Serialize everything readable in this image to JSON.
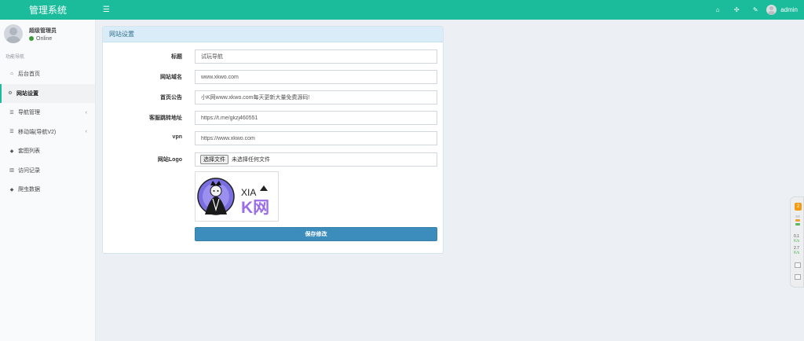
{
  "header": {
    "app_title": "管理系统",
    "menu_icon": "hamburger-icon",
    "right_icons": [
      "home-icon",
      "expand-icon",
      "wrench-icon"
    ],
    "user": "admin"
  },
  "sidebar": {
    "user_name": "超级管理员",
    "status": "Online",
    "nav_header": "功能导航",
    "items": [
      {
        "label": "后台首页",
        "icon": "home-icon",
        "glyph": "⌂"
      },
      {
        "label": "网站设置",
        "icon": "gears-icon",
        "glyph": "⚙"
      },
      {
        "label": "导航管理",
        "icon": "database-icon",
        "glyph": "☰"
      },
      {
        "label": "移动端(导航V2)",
        "icon": "database-icon",
        "glyph": "☰"
      },
      {
        "label": "套图列表",
        "icon": "tags-icon",
        "glyph": "◆"
      },
      {
        "label": "访问记录",
        "icon": "bar-chart-icon",
        "glyph": "▥"
      },
      {
        "label": "爬虫数据",
        "icon": "tag-icon",
        "glyph": "◆"
      }
    ]
  },
  "panel": {
    "title": "网站设置",
    "fields": {
      "title": {
        "label": "标题",
        "value": "试玩导航"
      },
      "domain": {
        "label": "网站域名",
        "value": "www.xkwo.com"
      },
      "notice": {
        "label": "首页公告",
        "value": "小K网www.xkwo.com每天更新大量免费源码!"
      },
      "support": {
        "label": "客服跳转地址",
        "value": "https://t.me/gkzj460551"
      },
      "vpn": {
        "label": "vpn",
        "value": "https://www.xkwo.com"
      },
      "logo": {
        "label": "网站Logo",
        "button": "选择文件",
        "no_file": "未选择任何文件"
      }
    },
    "logo_text_top": "XIA",
    "logo_text_bottom": "K网",
    "save_label": "保存修改"
  },
  "float_widget": {
    "badge": "2",
    "stat1": "0.1",
    "stat1_unit": "K/s",
    "stat2": "2.7",
    "stat2_unit": "K/s"
  },
  "colors": {
    "header": "#1abc9c",
    "primary_button": "#3c8dbc",
    "panel_header": "#d9ecf7",
    "online": "#3c9a3c"
  }
}
